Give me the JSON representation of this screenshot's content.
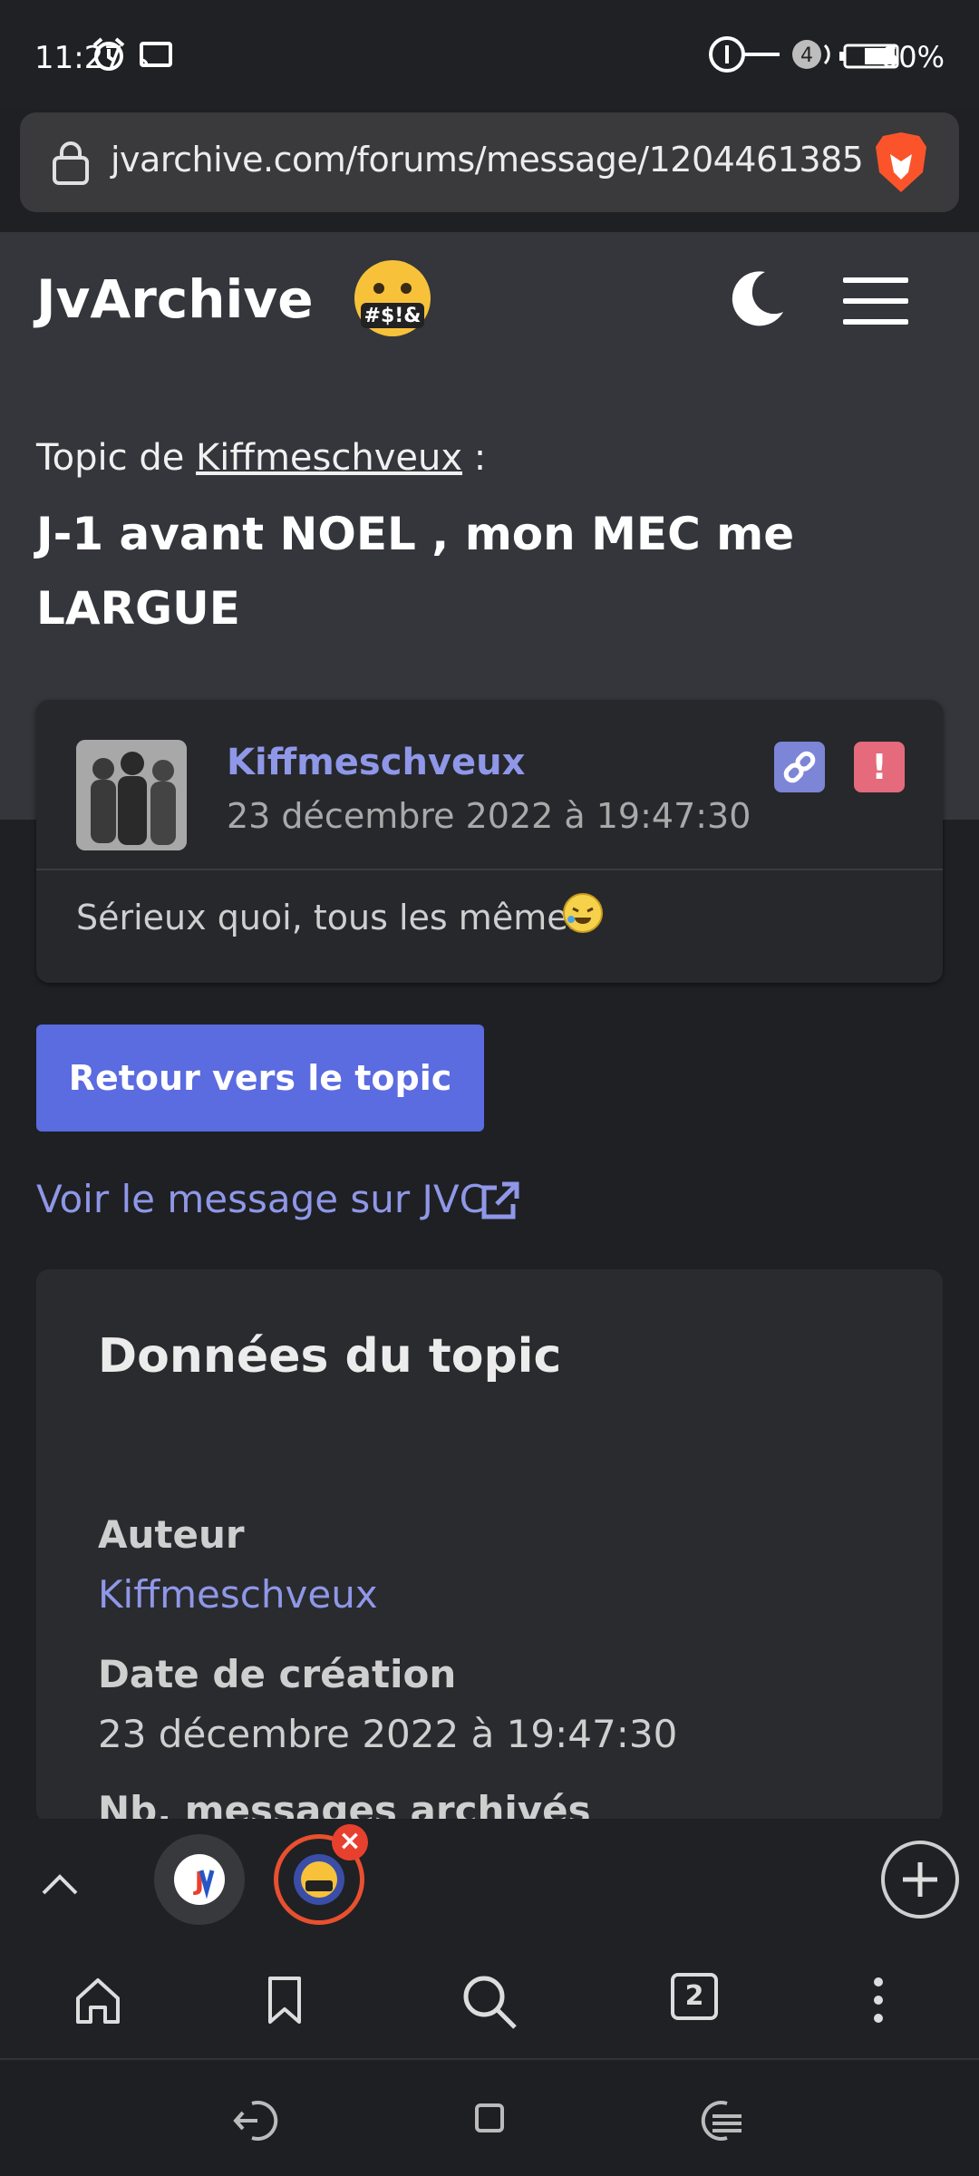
{
  "status_bar": {
    "time": "11:27",
    "battery": "60%",
    "notification_count": "4",
    "icons": [
      "alarm-icon",
      "cast-icon",
      "key-icon",
      "chat-icon",
      "battery-icon"
    ]
  },
  "browser": {
    "url": "jvarchive.com/forums/message/1204461385",
    "tab_count": "2"
  },
  "site": {
    "logo": "JvArchive"
  },
  "topic": {
    "prefix": "Topic de ",
    "author": "Kiffmeschveux",
    "suffix": " :",
    "title": "J-1 avant NOEL , mon MEC me LARGUE"
  },
  "message": {
    "author": "Kiffmeschveux",
    "date": "23 décembre 2022 à 19:47:30",
    "body": "Sérieux quoi, tous les mêmes",
    "report_symbol": "!"
  },
  "actions": {
    "back_button": "Retour vers le topic",
    "jvc_link": "Voir le message sur JVC"
  },
  "topic_data": {
    "heading": "Données du topic",
    "author_label": "Auteur",
    "author_value": "Kiffmeschveux",
    "created_label": "Date de création",
    "created_value": "23 décembre 2022 à 19:47:30",
    "archived_label": "Nb. messages archivés"
  },
  "colors": {
    "accent": "#5b6be0",
    "link": "#8f97e8",
    "report": "#e46a7c"
  }
}
